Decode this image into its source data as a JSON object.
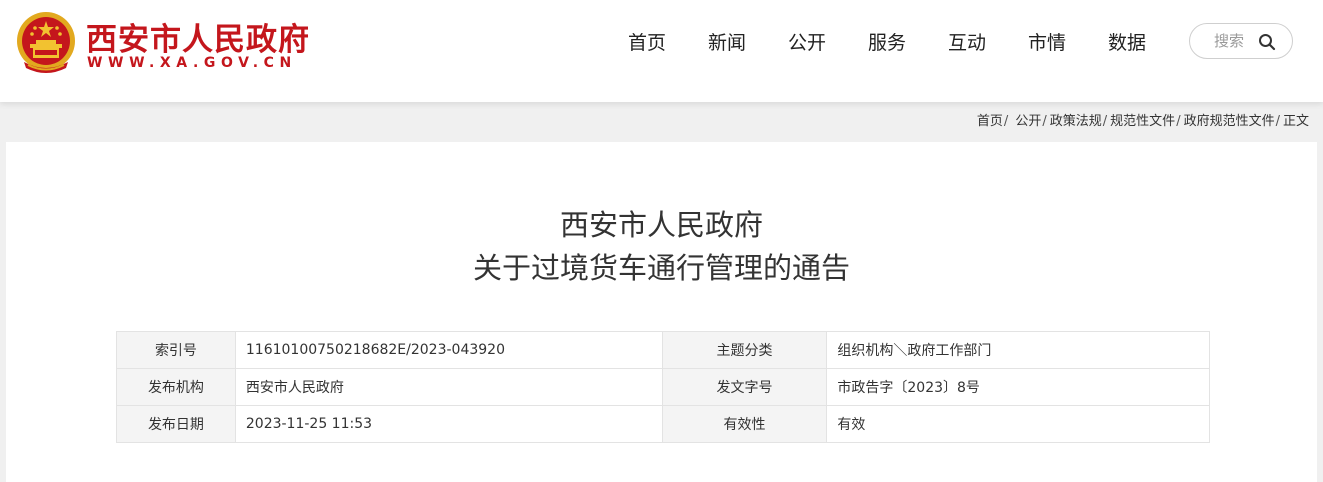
{
  "header": {
    "site_title": "西安市人民政府",
    "site_url": "WWW.XA.GOV.CN",
    "brand_color": "#c4161c",
    "logo_icon": "national-emblem-icon",
    "nav": [
      "首页",
      "新闻",
      "公开",
      "服务",
      "互动",
      "市情",
      "数据"
    ],
    "search": {
      "label": "搜索",
      "icon": "search-icon"
    }
  },
  "breadcrumb": [
    "首页",
    "公开",
    "政策法规",
    "规范性文件",
    "政府规范性文件",
    "正文"
  ],
  "article": {
    "title_line1": "西安市人民政府",
    "title_line2": "关于过境货车通行管理的通告"
  },
  "meta": {
    "rows": [
      {
        "label1": "索引号",
        "value1": "11610100750218682E/2023-043920",
        "label2": "主题分类",
        "value2": "组织机构＼政府工作部门"
      },
      {
        "label1": "发布机构",
        "value1": "西安市人民政府",
        "label2": "发文字号",
        "value2": "市政告字〔2023〕8号"
      },
      {
        "label1": "发布日期",
        "value1": "2023-11-25 11:53",
        "label2": "有效性",
        "value2": "有效"
      }
    ]
  }
}
